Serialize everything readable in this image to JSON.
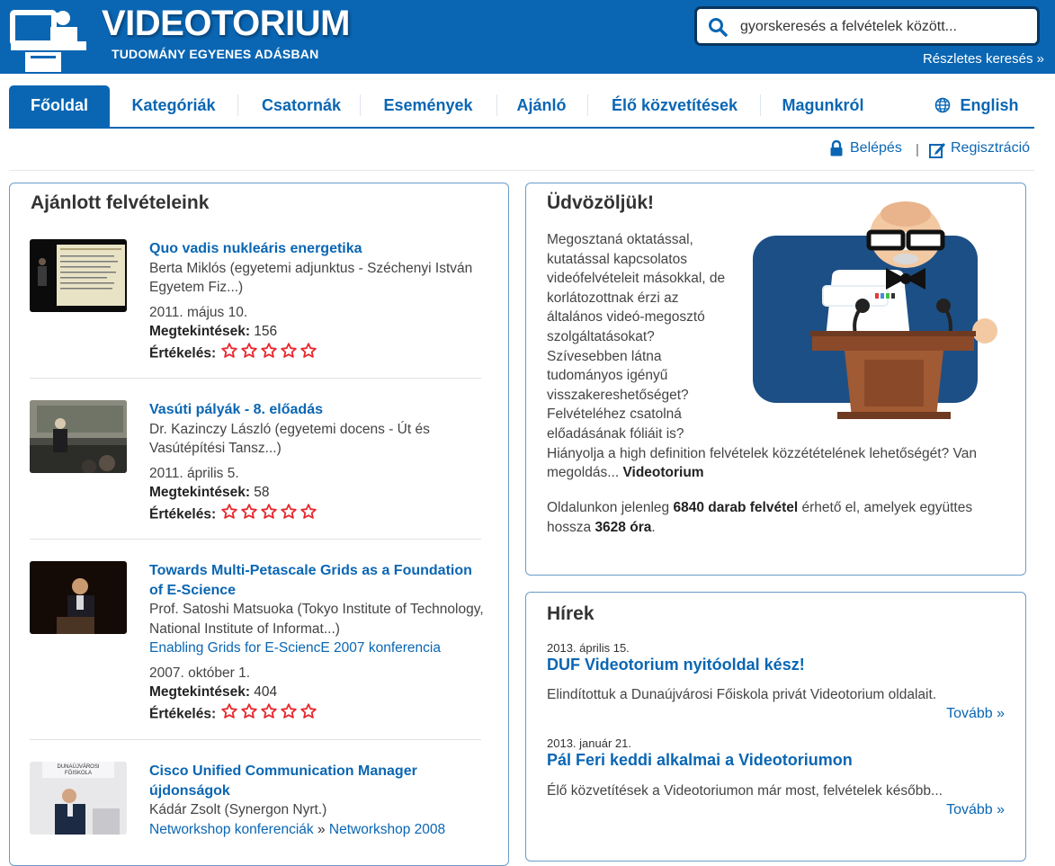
{
  "header": {
    "logo_title": "VIDEOTORIUM",
    "logo_subtitle": "TUDOMÁNY EGYENES ADÁSBAN",
    "search_placeholder": "gyorskeresés a felvételek között...",
    "advanced_search": "Részletes keresés »",
    "search_icon": "search-icon",
    "logo_icon": "lecturer-icon"
  },
  "nav": {
    "items": [
      {
        "label": "Főoldal",
        "active": true
      },
      {
        "label": "Kategóriák"
      },
      {
        "label": "Csatornák"
      },
      {
        "label": "Események"
      },
      {
        "label": "Ajánló"
      },
      {
        "label": "Élő közvetítések"
      },
      {
        "label": "Magunkról"
      }
    ],
    "language": "English",
    "language_icon": "globe-icon"
  },
  "account": {
    "login": "Belépés",
    "separator": "|",
    "register": "Regisztráció",
    "login_icon": "lock-icon",
    "register_icon": "edit-icon"
  },
  "featured": {
    "title": "Ajánlott felvételeink",
    "views_label": "Megtekintések:",
    "rating_label": "Értékelés:",
    "items": [
      {
        "title": "Quo vadis nukleáris energetika",
        "author": "Berta Miklós (egyetemi adjunktus - Széchenyi István Egyetem Fiz...)",
        "date": "2011. május 10.",
        "views": "156"
      },
      {
        "title": "Vasúti pályák - 8. előadás",
        "author": "Dr. Kazinczy László (egyetemi docens - Út és Vasútépítési Tansz...)",
        "date": "2011. április 5.",
        "views": "58"
      },
      {
        "title": "Towards Multi-Petascale Grids as a Foundation of E-Science",
        "author": "Prof. Satoshi Matsuoka (Tokyo Institute of Technology, National Institute of Informat...)",
        "conference": "Enabling Grids for E-SciencE 2007 konferencia",
        "date": "2007. október 1.",
        "views": "404"
      },
      {
        "title": "Cisco Unified Communication Manager újdonságok",
        "author": "Kádár Zsolt (Synergon Nyrt.)",
        "conference_a": "Networkshop konferenciák",
        "conference_sep": "»",
        "conference_b": "Networkshop 2008",
        "thumb_sign_1": "DUNAÚJVÁROSI",
        "thumb_sign_2": "FŐISKOLA"
      }
    ]
  },
  "welcome": {
    "title": "Üdvözöljük!",
    "text_narrow": "Megosztaná oktatással, kutatással kapcsolatos videófelvételeit másokkal, de korlátozottnak érzi az általános videó-megosztó szolgáltatásokat? Szívesebben látna tudományos igényű visszakereshetőséget? Felvételéhez csatolná előadásának fóliáit is?",
    "text_wide": "Hiányolja a high definition felvételek közzétételének lehetőségét? Van megoldás...",
    "brand": "Videotorium",
    "stats_prefix": "Oldalunkon jelenleg",
    "stats_count": "6840 darab felvétel",
    "stats_middle": "érhető el, amelyek együttes hossza",
    "stats_hours": "3628 óra",
    "stats_suffix": "."
  },
  "news": {
    "title": "Hírek",
    "more_label": "Tovább »",
    "items": [
      {
        "date": "2013. április 15.",
        "title": "DUF Videotorium nyitóoldal kész!",
        "text": "Elindítottuk a Dunaújvárosi Főiskola privát Videotorium oldalait."
      },
      {
        "date": "2013. január 21.",
        "title": "Pál Feri keddi alkalmai a Videotoriumon",
        "text": "Élő közvetítések a Videotoriumon már most, felvételek később..."
      }
    ]
  },
  "colors": {
    "brand_blue": "#0a66b3",
    "header_dark": "#07355e",
    "star_red": "#e8262c"
  }
}
